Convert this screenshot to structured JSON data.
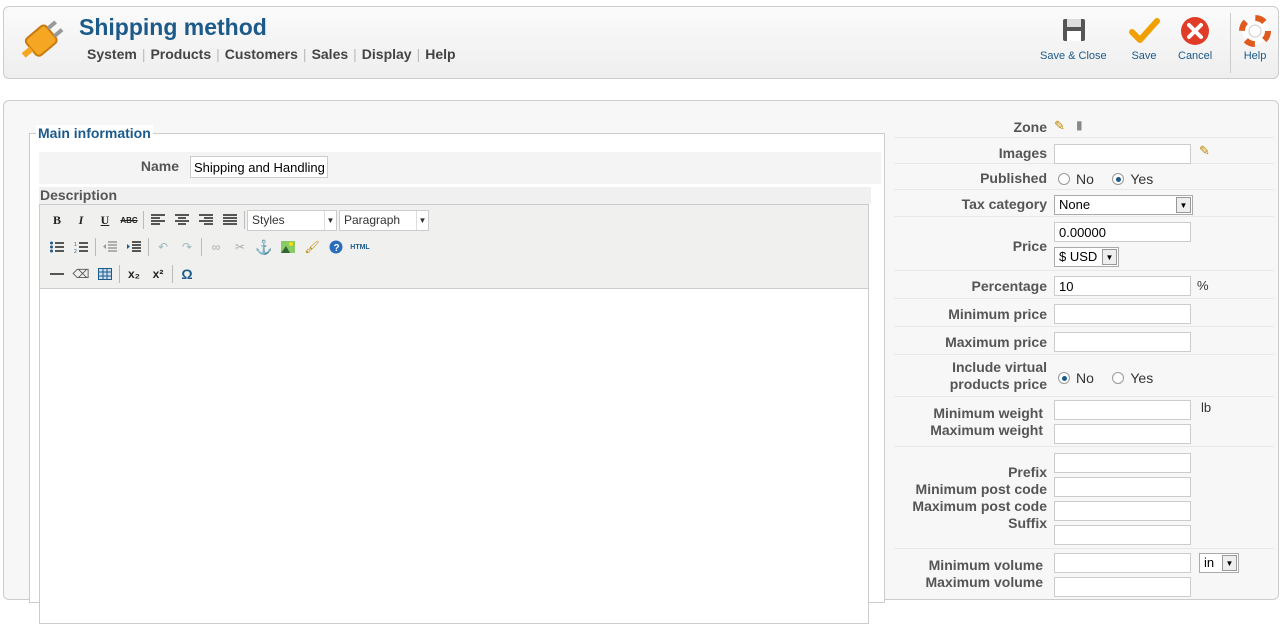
{
  "header": {
    "title": "Shipping method",
    "menu": [
      "System",
      "Products",
      "Customers",
      "Sales",
      "Display",
      "Help"
    ]
  },
  "toolbar": {
    "save_close": "Save & Close",
    "save": "Save",
    "cancel": "Cancel",
    "help": "Help"
  },
  "main": {
    "legend": "Main information",
    "name_label": "Name",
    "name_value": "Shipping and Handling",
    "description_label": "Description",
    "editor": {
      "bold": "B",
      "italic": "I",
      "underline": "U",
      "strike": "ABC",
      "styles": "Styles",
      "format": "Paragraph",
      "html": "HTML",
      "sub": "x₂",
      "sup": "x²",
      "omega": "Ω"
    }
  },
  "right": {
    "zone_label": "Zone",
    "images_label": "Images",
    "published_label": "Published",
    "no": "No",
    "yes": "Yes",
    "tax_label": "Tax category",
    "tax_value": "None",
    "price_label": "Price",
    "price_value": "0.00000",
    "currency": "$ USD",
    "percentage_label": "Percentage",
    "percentage_value": "10",
    "percent_sign": "%",
    "min_price_label": "Minimum price",
    "max_price_label": "Maximum price",
    "virtual_label_1": "Include virtual",
    "virtual_label_2": "products price",
    "min_weight_label": "Minimum weight",
    "max_weight_label": "Maximum weight",
    "weight_unit": "lb",
    "prefix_label": "Prefix",
    "min_post_label": "Minimum post code",
    "max_post_label": "Maximum post code",
    "suffix_label": "Suffix",
    "min_volume_label": "Minimum volume",
    "max_volume_label": "Maximum volume",
    "volume_unit": "in"
  }
}
